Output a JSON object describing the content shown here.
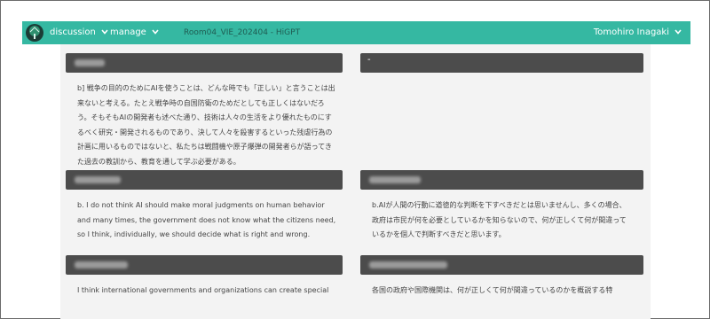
{
  "navbar": {
    "menu": [
      {
        "label": "discussion"
      },
      {
        "label": "manage"
      }
    ],
    "room_title": "Room04_VIE_202404 - HiGPT",
    "user_name": "Tomohiro Inagaki"
  },
  "posts": [
    {
      "text": "b] 戦争の目的のためにAIを使うことは、どんな時でも「正しい」と言うことは出来ないと考える。たとえ戦争時の自国防衛のためだとしても正しくはないだろう。そもそもAIの開発者も述べた通り、技術は人々の生活をより優れたものにするべく研究・開発されるものであり、決して人々を殺害するといった残虐行為の計画に用いるものではないと、私たちは戦闘機や原子爆弾の開発者らが語ってきた過去の教訓から、教育を通して学ぶ必要がある。"
    },
    {
      "text": ""
    },
    {
      "text": "b. I do not think AI should make moral judgments on human behavior and many times, the government does not know what the citizens need, so I think, individually, we should decide what is right and wrong."
    },
    {
      "text": "b.AIが人間の行動に道徳的な判断を下すべきだとは思いませんし、多くの場合、政府は市民が何を必要としているかを知らないので、何が正しくて何が間違っているかを個人で判断すべきだと思います。"
    },
    {
      "text": "I think international governments and organizations can create special"
    },
    {
      "text": "各国の政府や国際機関は、何が正しくて何が間違っているのかを概説する特"
    }
  ],
  "colors": {
    "navbar": "#35b8a2",
    "card_header": "#4c4c4c",
    "content_bg": "#f3f3f3"
  }
}
